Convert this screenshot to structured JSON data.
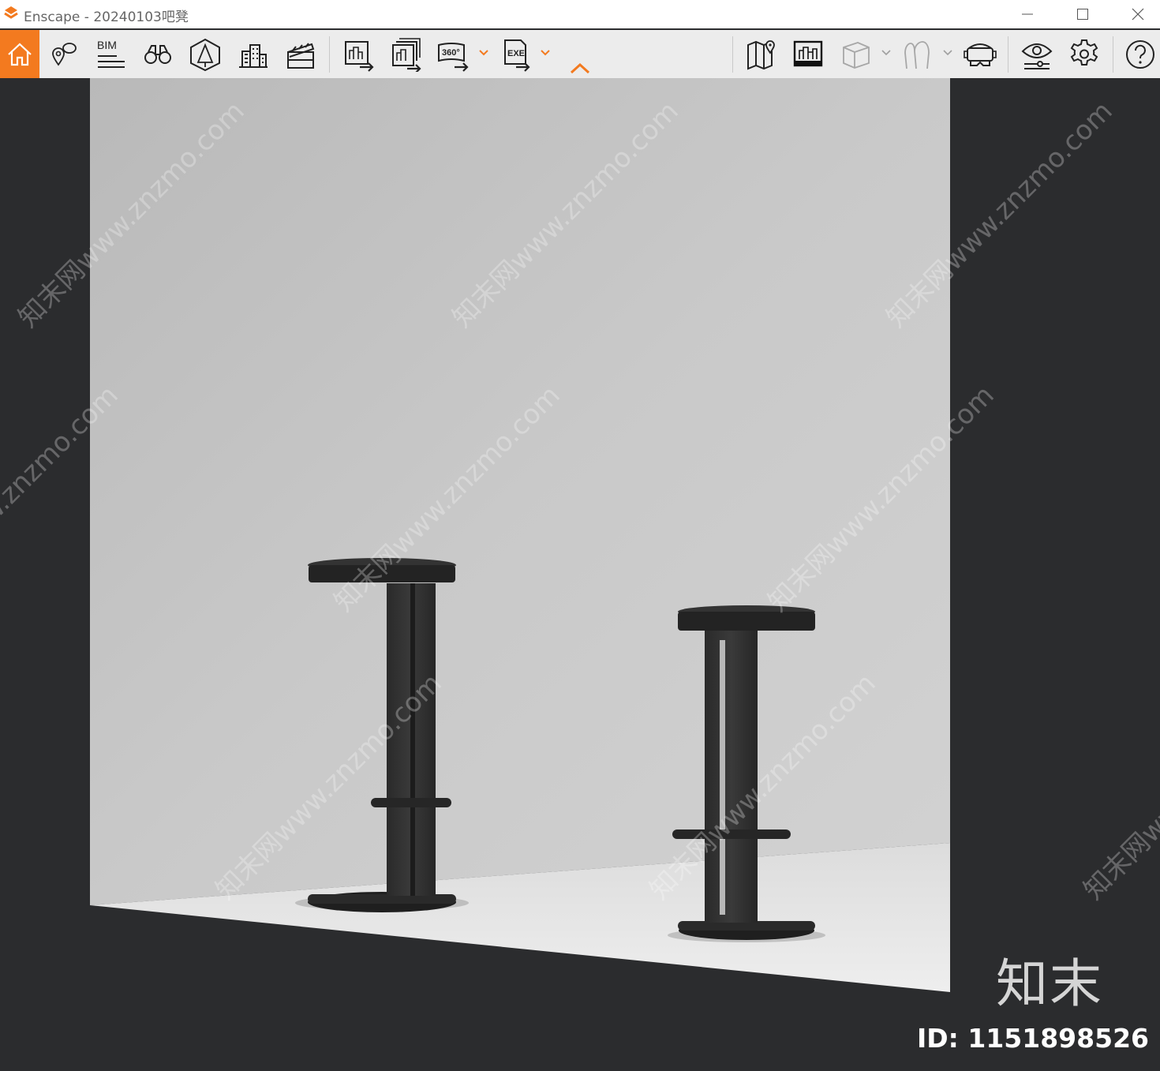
{
  "window": {
    "title": "Enscape - 20240103吧凳",
    "controls": [
      "minimize-icon",
      "maximize-icon",
      "close-icon"
    ]
  },
  "toolbar": {
    "bim_label": "BIM",
    "btn_360_label": "360°",
    "exe_label": "EXE",
    "accent_color": "#f37a1f",
    "icons": [
      "home-icon",
      "location-icon",
      "bim-icon",
      "binoculars-icon",
      "orthographic-icon",
      "buildings-icon",
      "clapperboard-icon",
      "render-image-icon",
      "batch-render-icon",
      "render-360-icon",
      "export-exe-icon",
      "collapse-icon",
      "map-icon",
      "view-management-icon",
      "box-icon",
      "people-icon",
      "vr-headset-icon",
      "visual-settings-icon",
      "settings-gear-icon",
      "help-icon"
    ]
  },
  "viewport": {
    "watermark_text": "知末网www.znzmo.com",
    "brand_text": "知末",
    "id_text": "ID: 1151898526"
  }
}
